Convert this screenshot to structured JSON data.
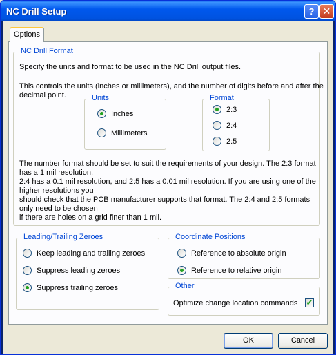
{
  "window": {
    "title": "NC Drill Setup",
    "help_glyph": "?",
    "close_glyph": "✕"
  },
  "tabs": [
    {
      "label": "Options"
    }
  ],
  "nc_drill_format": {
    "legend": "NC Drill Format",
    "desc1": "Specify the units and format to be used in the NC Drill output files.",
    "desc2_line1": "This controls the units (inches or millimeters), and the number of digits before and after the",
    "desc2_line2": "decimal point.",
    "units": {
      "legend": "Units",
      "options": [
        {
          "label": "Inches",
          "selected": true
        },
        {
          "label": "Millimeters",
          "selected": false
        }
      ]
    },
    "format": {
      "legend": "Format",
      "options": [
        {
          "label": "2:3",
          "selected": true
        },
        {
          "label": "2:4",
          "selected": false
        },
        {
          "label": "2:5",
          "selected": false
        }
      ]
    },
    "note_lines": [
      "The number format should be set to suit the requirements of your design. The 2:3 format",
      "has a 1 mil resolution,",
      "2:4 has a 0.1 mil resolution, and 2:5 has a 0.01 mil resolution. If you are using one of the",
      "higher resolutions you",
      "should check that the PCB manufacturer supports that format. The 2:4 and 2:5 formats",
      "only need to be chosen",
      "if there are holes on a grid finer than 1 mil."
    ]
  },
  "zeroes": {
    "legend": "Leading/Trailing Zeroes",
    "options": [
      {
        "label": "Keep leading and trailing zeroes",
        "selected": false
      },
      {
        "label": "Suppress leading zeroes",
        "selected": false
      },
      {
        "label": "Suppress trailing zeroes",
        "selected": true
      }
    ]
  },
  "coordinates": {
    "legend": "Coordinate Positions",
    "options": [
      {
        "label": "Reference to absolute origin",
        "selected": false
      },
      {
        "label": "Reference to relative origin",
        "selected": true
      }
    ]
  },
  "other": {
    "legend": "Other",
    "optimize_label": "Optimize change location commands",
    "optimize_checked": true,
    "check_glyph": "✔"
  },
  "buttons": {
    "ok": "OK",
    "cancel": "Cancel"
  },
  "colors": {
    "titlebar": "#0058ee",
    "legend": "#0046d5",
    "dialog_bg": "#ece9d8",
    "panel_bg": "#fcfcfe"
  }
}
